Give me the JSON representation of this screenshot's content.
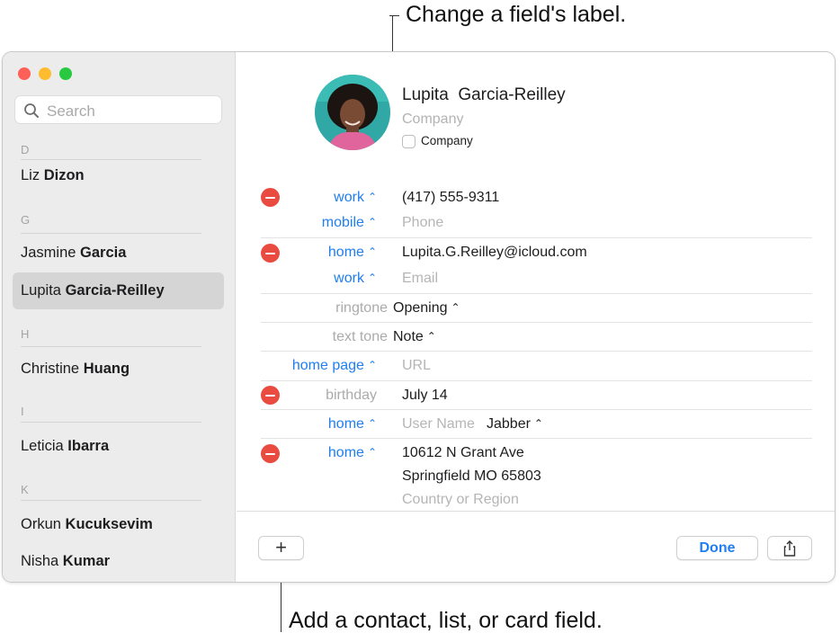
{
  "annotations": {
    "top": "Change a field's label.",
    "bottom": "Add a contact, list, or card field."
  },
  "window": {
    "colors": {
      "close": "#fe5f57",
      "minimize": "#febc2e",
      "maximize": "#28c840",
      "accent": "#1f7ef0",
      "remove": "#ea4b40"
    }
  },
  "sidebar": {
    "search_placeholder": "Search",
    "sections": [
      {
        "letter": "D",
        "contacts": [
          {
            "first": "Liz",
            "last": "Dizon"
          }
        ]
      },
      {
        "letter": "G",
        "contacts": [
          {
            "first": "Jasmine",
            "last": "Garcia"
          },
          {
            "first": "Lupita",
            "last": "Garcia-Reilley",
            "selected": true
          }
        ]
      },
      {
        "letter": "H",
        "contacts": [
          {
            "first": "Christine",
            "last": "Huang"
          }
        ]
      },
      {
        "letter": "I",
        "contacts": [
          {
            "first": "Leticia",
            "last": "Ibarra"
          }
        ]
      },
      {
        "letter": "K",
        "contacts": [
          {
            "first": "Orkun",
            "last": "Kucuksevim"
          },
          {
            "first": "Nisha",
            "last": "Kumar"
          }
        ]
      }
    ]
  },
  "card": {
    "name": "Lupita  Garcia-Reilley",
    "company_placeholder": "Company",
    "company_checkbox_label": "Company",
    "fields": {
      "phone1": {
        "label": "work",
        "value": "(417) 555-9311"
      },
      "phone2": {
        "label": "mobile",
        "placeholder": "Phone"
      },
      "email1": {
        "label": "home",
        "value": "Lupita.G.Reilley@icloud.com"
      },
      "email2": {
        "label": "work",
        "placeholder": "Email"
      },
      "ringtone": {
        "label": "ringtone",
        "value": "Opening"
      },
      "texttone": {
        "label": "text tone",
        "value": "Note"
      },
      "homepage": {
        "label": "home page",
        "placeholder": "URL"
      },
      "birthday": {
        "label": "birthday",
        "value": "July 14"
      },
      "im": {
        "label": "home",
        "placeholder": "User Name",
        "service": "Jabber"
      },
      "address": {
        "label": "home",
        "street": "10612 N Grant Ave",
        "city_line": "Springfield MO 65803",
        "country_placeholder": "Country or Region"
      }
    }
  },
  "footer": {
    "add_label": "+",
    "done_label": "Done",
    "share_icon": "share-icon"
  }
}
